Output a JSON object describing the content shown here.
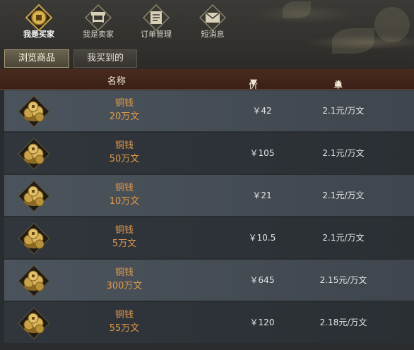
{
  "nav": [
    {
      "label": "我是买家",
      "icon": "buyer-coin-icon",
      "active": true
    },
    {
      "label": "我是卖家",
      "icon": "seller-stall-icon",
      "active": false
    },
    {
      "label": "订单管理",
      "icon": "order-book-icon",
      "active": false
    },
    {
      "label": "短消息",
      "icon": "envelope-icon",
      "active": false
    }
  ],
  "tabs": [
    {
      "label": "浏览商品",
      "active": true
    },
    {
      "label": "我买到的",
      "active": false
    }
  ],
  "table": {
    "columns": {
      "name": "名称",
      "price": "价钱",
      "unit_price": "单价"
    },
    "rows": [
      {
        "name": "铜钱",
        "amount": "20万文",
        "price": "￥42",
        "unit_price": "2.1元/万文"
      },
      {
        "name": "铜钱",
        "amount": "50万文",
        "price": "￥105",
        "unit_price": "2.1元/万文"
      },
      {
        "name": "铜钱",
        "amount": "10万文",
        "price": "￥21",
        "unit_price": "2.1元/万文"
      },
      {
        "name": "铜钱",
        "amount": "5万文",
        "price": "￥10.5",
        "unit_price": "2.1元/万文"
      },
      {
        "name": "铜钱",
        "amount": "300万文",
        "price": "￥645",
        "unit_price": "2.15元/万文"
      },
      {
        "name": "铜钱",
        "amount": "55万文",
        "price": "￥120",
        "unit_price": "2.18元/万文"
      }
    ]
  },
  "colors": {
    "item_name": "#e29a4a",
    "header_bg": "#3a2018",
    "accent_gold": "#c9a24a"
  }
}
